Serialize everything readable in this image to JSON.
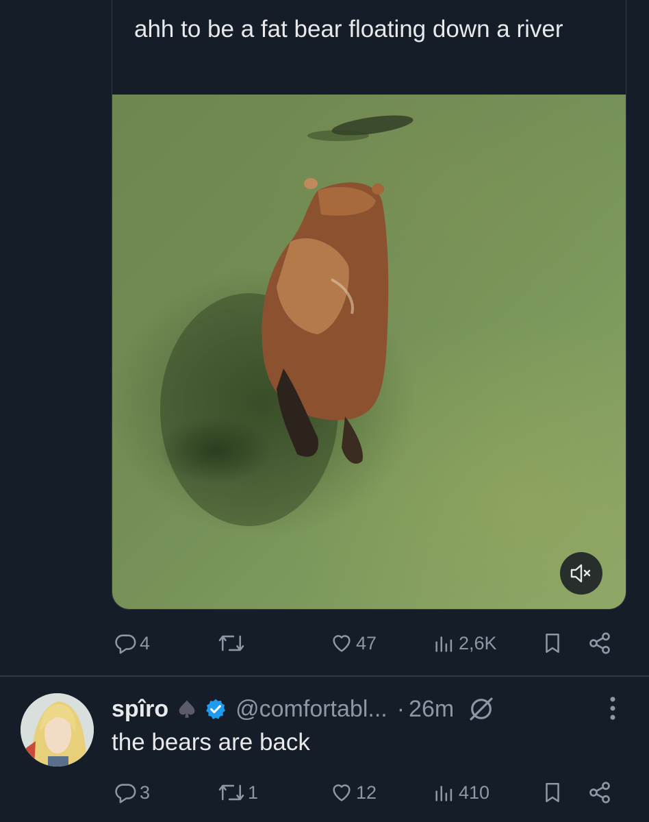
{
  "quoted_post": {
    "text": "ahh to be a fat bear floating down a river",
    "media": {
      "type": "video",
      "muted": true,
      "mute_icon": "volume-mute-icon"
    },
    "actions": {
      "replies": "4",
      "reposts": "",
      "likes": "47",
      "views": "2,6K"
    }
  },
  "reply_post": {
    "display_name": "spîro",
    "handle": "@comfortabl...",
    "separator": "·",
    "time": "26m",
    "badges": [
      "spade-icon",
      "verified-icon",
      "grok-icon"
    ],
    "text": "the bears are back",
    "actions": {
      "replies": "3",
      "reposts": "1",
      "likes": "12",
      "views": "410"
    }
  },
  "colors": {
    "background": "#151d28",
    "text": "#e7e9ea",
    "muted": "#8b98a5",
    "verified": "#1d9bf0",
    "divider": "#2f3b47"
  }
}
